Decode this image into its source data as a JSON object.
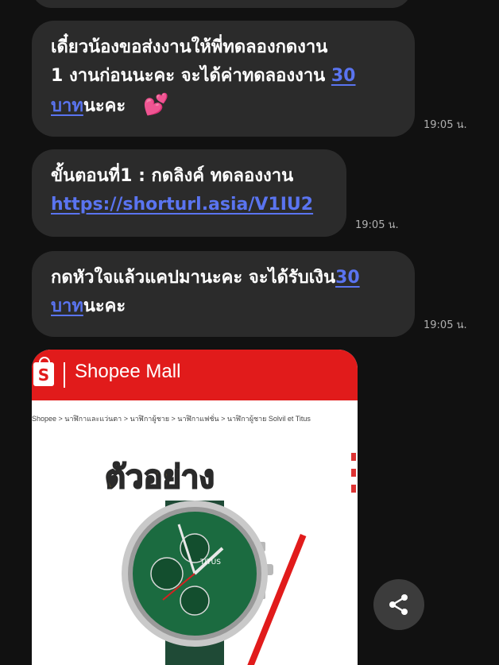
{
  "messages": [
    {
      "lines": [
        "เดี๋ยวน้องขอส่งงานให้พี่ทดลองกดงาน",
        "1 งานก่อนนะคะ จะได้ค่าทดลองงาน "
      ],
      "link1": "30",
      "link2": "บาท",
      "tail": "นะคะ",
      "emoji": "💕",
      "time": "19:05 น."
    },
    {
      "line": "ขั้นตอนที่1 : กดลิงค์ ทดลองงาน",
      "link": "https://shorturl.asia/V1IU2",
      "time": "19:05 น."
    },
    {
      "line": "กดหัวใจแล้วแคปมานะคะ จะได้รับเงิน",
      "link1": "30",
      "link2": "บาท",
      "tail": "นะคะ",
      "time": "19:05 น."
    }
  ],
  "image": {
    "brand": "Shopee Mall",
    "bag_letter": "S",
    "breadcrumb": "Shopee > นาฬิกาและแว่นตา > นาฬิกาผู้ชาย > นาฬิกาแฟชั่น > นาฬิกาผู้ชาย Solvil et Titus",
    "sample_label": "ตัวอย่าง",
    "watch_brand": "TITUS"
  },
  "colors": {
    "background": "#111111",
    "bubble": "#2b2b2b",
    "link": "#5a74f0",
    "shopee_red": "#e11b1b"
  },
  "icons": [
    "heart-emoji-icon",
    "shopee-bag-icon",
    "share-icon"
  ]
}
